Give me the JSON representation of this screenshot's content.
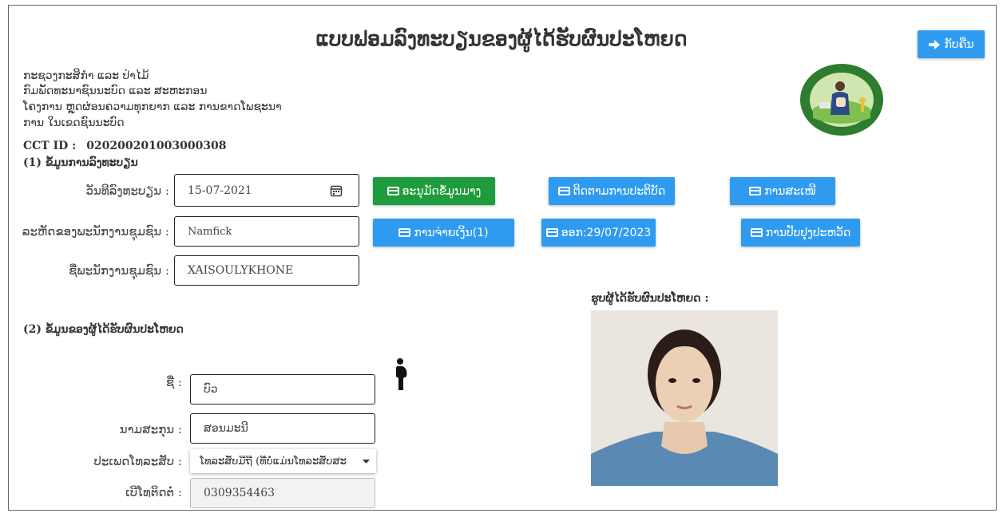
{
  "title": "ແບບຟອມລົງທະບຽນຂອງຜູ້ໄດ້ຮັບຜົນປະໂຫຍດ",
  "back_button": {
    "label": "ກັບຄືນ",
    "icon": "arrow-right-icon"
  },
  "organization": {
    "line1": "ກະຊວງກະສິກຳ ແລະ ປ່າໄມ້",
    "line2": "ກົມພັດທະນາຊົນນະບົດ ແລະ ສະຫະກອນ",
    "line3": "ໂຄງການ ຫຼຸດຜ່ອນຄວາມທຸກຍາກ ແລະ ການຂາດໂພຊະນາ",
    "line4": "ການ ໃນເຂດຊົນນະບົດ"
  },
  "cct": {
    "label": "CCT ID :",
    "value": "020200201003000308"
  },
  "section1": {
    "title": "(1) ຂໍ້ມູນການລົງທະບຽນ",
    "date_label": "ວັນທີລົງທະບຽນ :",
    "date_value": "15-07-2021",
    "staff_code_label": "ລະຫັດຂອງພະນັກງານຊຸມຊົນ :",
    "staff_code_value": "Namfick",
    "staff_name_label": "ຊື່ພະນັກງານຊຸມຊົນ :",
    "staff_name_value": "XAISOULYKHONE"
  },
  "actions": {
    "approve": "ອະນຸມັດຂໍ້ມູນມາງ",
    "track": "ຕິດຕາມການປະຕິບັດ",
    "propose": "ການສະເໜີ",
    "payment": "ການຈ່າຍເງິນ(1)",
    "exit": "ອອກ:29/07/2023",
    "update_history": "ການປັບປຸງປະຫວັດ"
  },
  "section2": {
    "title": "(2) ຂໍ້ມູນຂອງຜູ້ໄດ້ຮັບຜົນປະໂຫຍດ",
    "name_label": "ຊື່ :",
    "name_value": "ບົວ",
    "surname_label": "ນາມສະກຸນ :",
    "surname_value": "ສອນມະນີ",
    "phone_type_label": "ປະເພດໂທລະສັບ :",
    "phone_type_value": "ໂທລະສັບມືຖື (ທີ່ບໍ່ແມ່ນໂທລະສັບສະ",
    "phone_label": "ເບີໂທຕິດຕໍ່ :",
    "phone_value": "0309354463",
    "status_icon": "pregnant-woman-icon"
  },
  "photo": {
    "label": "ຮູບຜູ້ໄດ້ຮັບຜົນປະໂຫຍດ :"
  },
  "colors": {
    "primary": "#2f9bf0",
    "success": "#1e9b3c",
    "logo_green": "#2e7d2e"
  }
}
